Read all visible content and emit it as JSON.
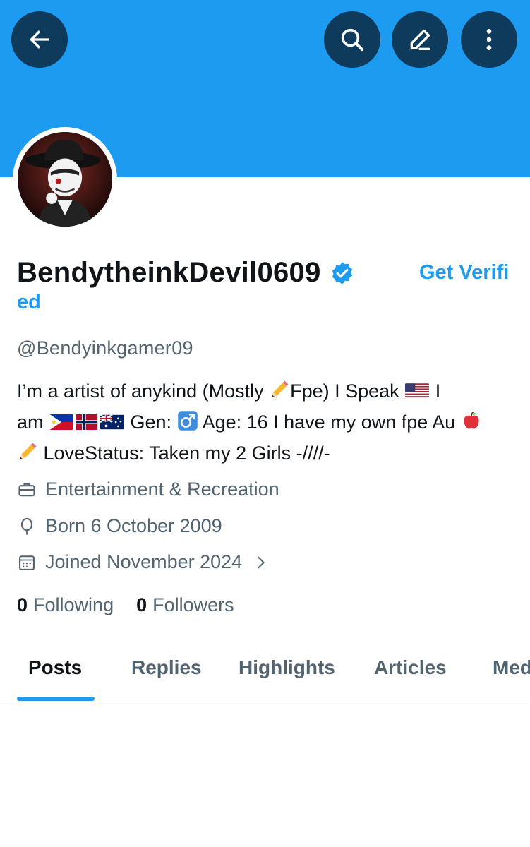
{
  "header": {
    "back_icon": "arrow-left-icon",
    "search_icon": "search-icon",
    "edit_icon": "pencil-icon",
    "more_icon": "more-vertical-icon",
    "banner_color": "#1d9bf0"
  },
  "profile": {
    "display_name": "BendytheinkDevil0609",
    "get_verified_part1": "Get Verifi",
    "get_verified_part2": "ed",
    "handle": "@Bendyinkgamer09",
    "bio": {
      "line1_a": "I’m a artist of anykind (Mostly ",
      "line1_b": "Fpe)  I Speak ",
      "line1_c": " I",
      "line2_a": "am ",
      "line2_b": " Gen: ",
      "line2_c": " Age: 16  I have my own fpe Au ",
      "line3_a": " LoveStatus: Taken my 2 Girls -////-"
    },
    "category": "Entertainment & Recreation",
    "born": "Born 6 October 2009",
    "joined": "Joined November 2024",
    "following_count": "0",
    "following_label": "Following",
    "followers_count": "0",
    "followers_label": "Followers"
  },
  "tabs": [
    {
      "label": "Posts",
      "active": true
    },
    {
      "label": "Replies",
      "active": false
    },
    {
      "label": "Highlights",
      "active": false
    },
    {
      "label": "Articles",
      "active": false
    },
    {
      "label": "Media",
      "active": false
    }
  ],
  "colors": {
    "accent": "#1d9bf0",
    "text": "#0f1419",
    "muted": "#536471"
  }
}
